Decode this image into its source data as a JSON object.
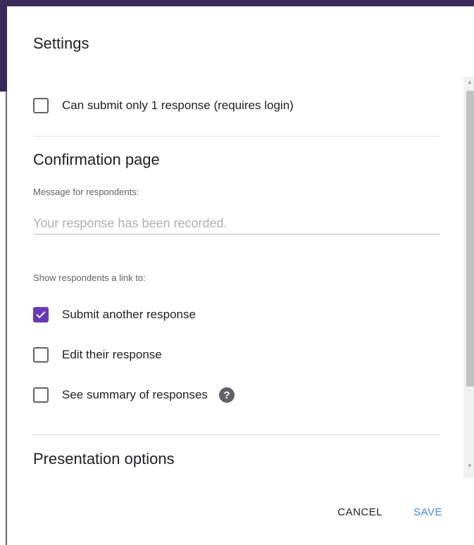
{
  "dialog": {
    "title": "Settings"
  },
  "settings": {
    "single_response_label": "Can submit only 1 response (requires login)",
    "single_response_checked": false
  },
  "confirmation": {
    "section_title": "Confirmation page",
    "message_label": "Message for respondents:",
    "message_value": "",
    "message_placeholder": "Your response has been recorded.",
    "show_link_label": "Show respondents a link to:",
    "options": [
      {
        "label": "Submit another response",
        "checked": true
      },
      {
        "label": "Edit their response",
        "checked": false
      },
      {
        "label": "See summary of responses",
        "checked": false
      }
    ],
    "help_icon": "question-mark-icon"
  },
  "presentation": {
    "section_title": "Presentation options"
  },
  "actions": {
    "cancel_label": "CANCEL",
    "save_label": "SAVE"
  },
  "colors": {
    "accent": "#673ab7",
    "save_button": "#4285f4"
  }
}
